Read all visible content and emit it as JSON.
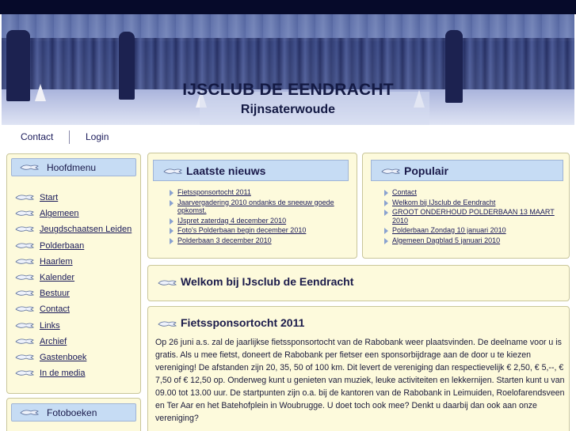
{
  "header": {
    "title": "IJSCLUB DE EENDRACHT",
    "subtitle": "Rijnsaterwoude"
  },
  "topnav": {
    "items": [
      {
        "label": "Contact"
      },
      {
        "label": "Login"
      }
    ]
  },
  "sidebar": {
    "heading": "Hoofdmenu",
    "items": [
      {
        "label": "Start"
      },
      {
        "label": "Algemeen"
      },
      {
        "label": "Jeugdschaatsen Leiden"
      },
      {
        "label": "Polderbaan"
      },
      {
        "label": "Haarlem"
      },
      {
        "label": "Kalender"
      },
      {
        "label": "Bestuur"
      },
      {
        "label": "Contact"
      },
      {
        "label": "Links"
      },
      {
        "label": "Archief"
      },
      {
        "label": "Gastenboek"
      },
      {
        "label": "In de media"
      }
    ],
    "heading2": "Fotoboeken"
  },
  "latest_news": {
    "heading": "Laatste nieuws",
    "items": [
      {
        "label": "Fietssponsortocht 2011"
      },
      {
        "label": "Jaarvergadering 2010 ondanks de sneeuw goede opkomst."
      },
      {
        "label": "IJspret zaterdag 4 december 2010"
      },
      {
        "label": "Foto's Polderbaan begin december 2010"
      },
      {
        "label": "Polderbaan 3 december 2010"
      }
    ]
  },
  "popular": {
    "heading": "Populair",
    "items": [
      {
        "label": "Contact"
      },
      {
        "label": "Welkom bij IJsclub de Eendracht"
      },
      {
        "label": "GROOT ONDERHOUD POLDERBAAN 13 MAART 2010"
      },
      {
        "label": "Polderbaan Zondag 10 januari 2010"
      },
      {
        "label": "Algemeen Dagblad 5 januari 2010"
      }
    ]
  },
  "welcome": {
    "heading": "Welkom bij IJsclub de Eendracht"
  },
  "article": {
    "heading": "Fietssponsortocht 2011",
    "body": "Op 26 juni a.s. zal de jaarlijkse fietssponsortocht van de Rabobank weer plaatsvinden. De deelname voor u is gratis. Als u mee fietst, doneert de Rabobank per fietser een sponsorbijdrage aan de door u te kiezen vereniging! De afstanden zijn 20, 35, 50 of 100 km. Dit levert de vereniging dan respectievelijk € 2,50, € 5,--, € 7,50 of € 12,50 op. Onderweg kunt u genieten van muziek, leuke activiteiten en lekkernijen. Starten kunt u van 09.00 tot 13.00 uur. De startpunten zijn o.a. bij de kantoren van de Rabobank in Leimuiden, Roelofarendsveen en Ter Aar en het Batehofplein in Woubrugge. U doet toch ook mee? Denkt u daarbij dan ook aan onze vereniging?"
  },
  "icons": {
    "bullet": "fish-icon",
    "list_marker": "triangle-bullet-icon"
  },
  "colors": {
    "header_bar": "#060a2a",
    "panel_bg": "#fdfadc",
    "panel_head_bg": "#c6dcf4",
    "text": "#1a1a4a"
  }
}
